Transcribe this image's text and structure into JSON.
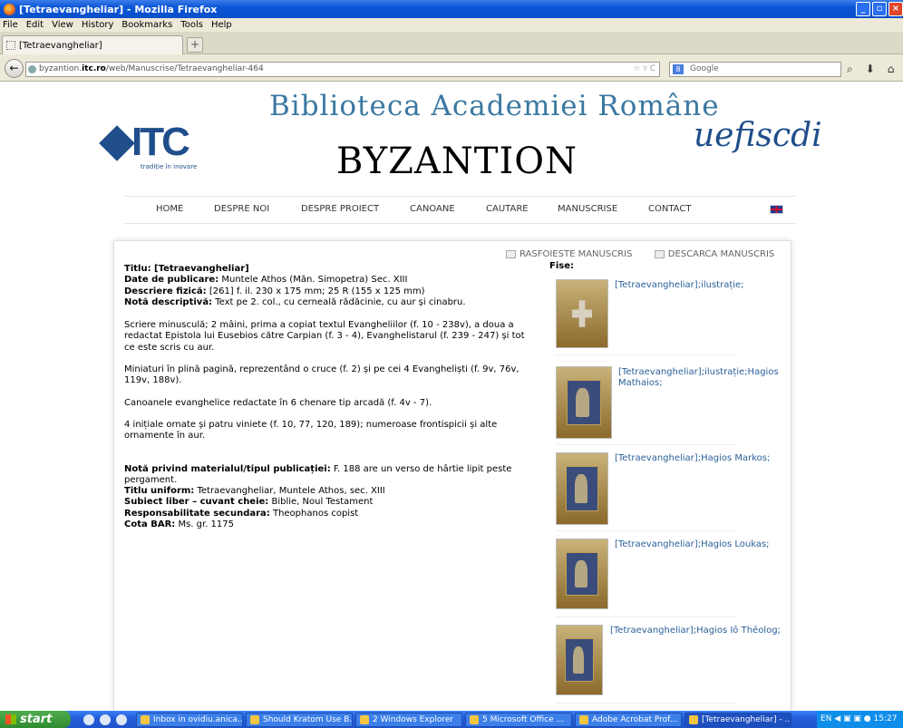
{
  "window": {
    "title": "[Tetraevangheliar] - Mozilla Firefox"
  },
  "menu": [
    "File",
    "Edit",
    "View",
    "History",
    "Bookmarks",
    "Tools",
    "Help"
  ],
  "tab": {
    "title": "[Tetraevangheliar]",
    "new_tab": "+"
  },
  "address": {
    "prefix": "byzantion.",
    "domain": "itc.ro",
    "path": "/web/Manuscrise/Tetraevangheliar-464",
    "search_placeholder": "Google"
  },
  "site": {
    "library_title": "Biblioteca Academiei Române",
    "title": "BYZANTION",
    "itc_logo": "ITC",
    "itc_tagline": "tradiție în inovare",
    "uefiscdi_logo": "uefiscdi",
    "nav": [
      "HOME",
      "DESPRE NOI",
      "DESPRE PROIECT",
      "CANOANE",
      "CAUTARE",
      "MANUSCRISE",
      "CONTACT"
    ]
  },
  "tools": {
    "browse": "RASFOIESTE MANUSCRIS",
    "download": "DESCARCA MANUSCRIS"
  },
  "record": {
    "titlu": "Titlu: [Tetraevangheliar]",
    "date_label": "Date de publicare:",
    "date_value": " Muntele Athos (Măn. Simopetra) Sec. XIII",
    "descriere_label": "Descriere fizică:",
    "descriere_value": " [261] f. il. 230 x 175 mm; 25 R (155 x 125 mm)",
    "nota_label": "Notă descriptivă:",
    "nota_value": " Text pe 2. col., cu cerneală rădăcinie, cu aur și cinabru.",
    "p1": "Scriere minusculă; 2 mâini, prima a copiat textul Evangheliilor (f. 10 - 238v), a doua a redactat Epistola lui Eusebios către Carpian (f. 3 - 4), Evanghelistarul (f. 239 - 247) și tot ce este scris cu aur.",
    "p2": "Miniaturi în plină pagină, reprezentând o cruce (f. 2) și pe cei 4 Evangheliști (f. 9v, 76v, 119v, 188v).",
    "p3": "Canoanele evanghelice redactate în 6 chenare tip arcadă (f. 4v - 7).",
    "p4": "4 inițiale ornate și patru viniete (f. 10, 77, 120, 189); numeroase frontispicii și alte ornamente în aur.",
    "material_label": "Notă privind materialul/tipul publicației:",
    "material_value": " F. 188 are un verso de hârtie lipit peste pergament.",
    "uniform_label": "Titlu uniform:",
    "uniform_value": " Tetraevangheliar, Muntele Athos, sec. XIII",
    "subiect_label": "Subiect liber – cuvant cheie:",
    "subiect_value": " Biblie, Noul Testament",
    "resp_label": "Responsabilitate secundara:",
    "resp_value": " Theophanos copist",
    "cota_label": "Cota BAR:",
    "cota_value": " Ms. gr. 1175"
  },
  "fise_label": "Fise:",
  "fise": [
    "[Tetraevangheliar];ilustrație;",
    "[Tetraevangheliar];ilustrație;Hagios Mathaios;",
    "[Tetraevangheliar];Hagios Markos;",
    "[Tetraevangheliar];Hagios Loukas;",
    "[Tetraevangheliar];Hagios Iō Thēolog;"
  ],
  "taskbar": {
    "start": "start",
    "items": [
      "Inbox in ovidiu.anica...",
      "Should Kratom Use B...",
      "2 Windows Explorer",
      "5 Microsoft Office ...",
      "Adobe Acrobat Prof...",
      "[Tetraevangheliar] - ..."
    ],
    "tray": "EN",
    "clock": "15:27"
  }
}
